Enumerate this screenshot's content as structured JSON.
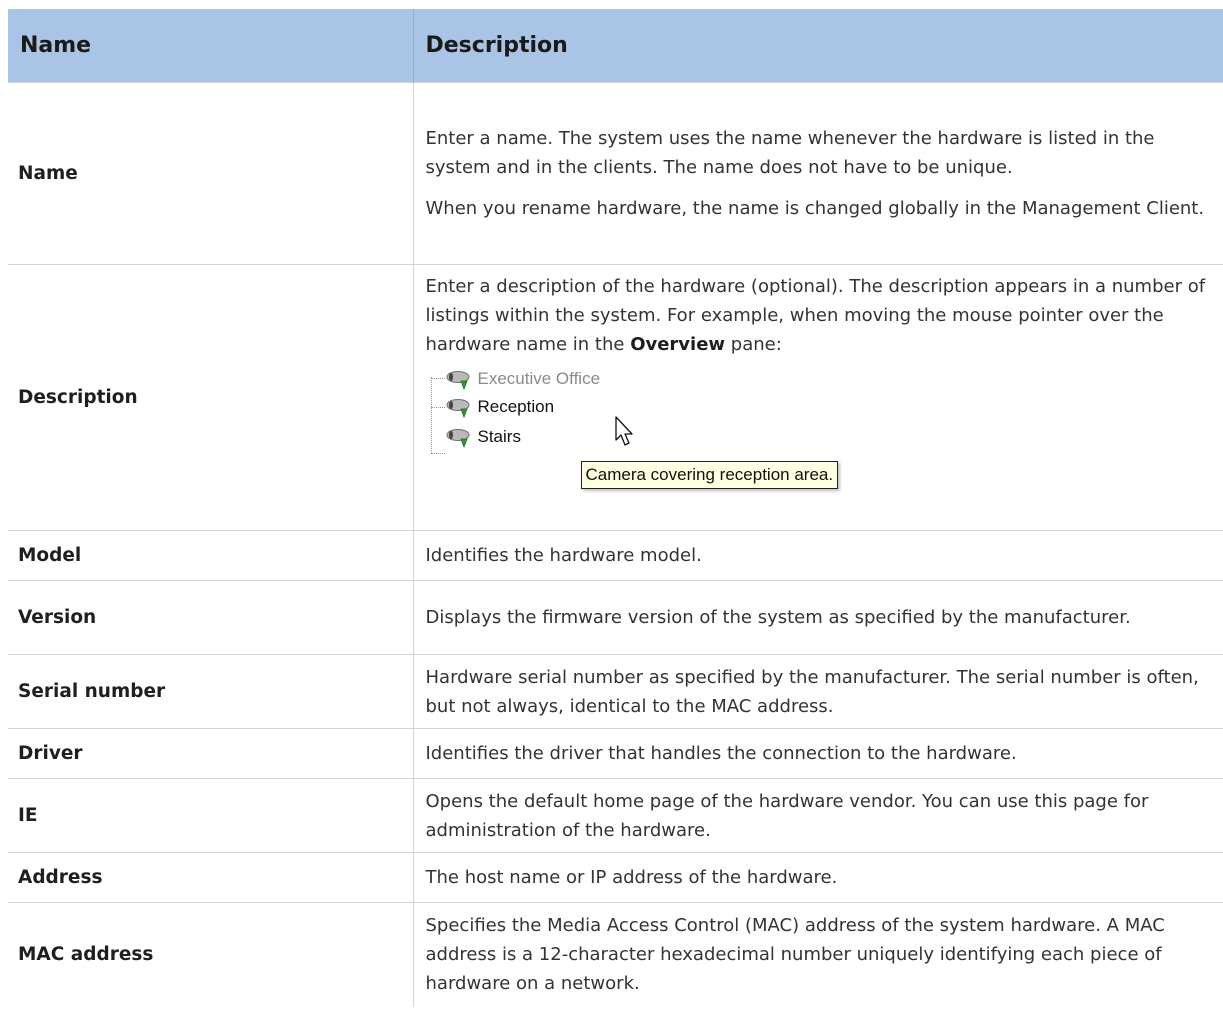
{
  "table": {
    "headers": {
      "name": "Name",
      "description": "Description"
    },
    "rows": [
      {
        "name": "Name",
        "paragraphs": [
          "Enter a name. The system uses the name whenever the hardware is listed in the system and in the clients. The name does not have to be unique.",
          "When you rename hardware, the name is changed globally in the Management Client."
        ]
      },
      {
        "name": "Description",
        "text_before": "Enter a description of the hardware (optional). The description appears in a number of listings within the system. For example, when moving the mouse pointer over the hardware name in the",
        "bold_word": "Overview",
        "text_after": "pane:"
      },
      {
        "name": "Model",
        "text": "Identifies the hardware model."
      },
      {
        "name": "Version",
        "text": "Displays the firmware version of the system as specified by the manufacturer."
      },
      {
        "name": "Serial number",
        "text": "Hardware serial number as specified by the manufacturer. The serial number is often, but not always, identical to the MAC address."
      },
      {
        "name": "Driver",
        "text": "Identifies the driver that handles the connection to the hardware."
      },
      {
        "name": "IE",
        "text": "Opens the default home page of the hardware vendor. You can use this page for administration of the hardware."
      },
      {
        "name": "Address",
        "text": "The host name or IP address of the hardware."
      },
      {
        "name": "MAC address",
        "text": "Specifies the Media Access Control (MAC) address of the system hardware. A MAC address is a 12-character hexadecimal number uniquely identifying each piece of hardware on a network."
      }
    ]
  },
  "screenshot": {
    "items": [
      "Executive Office",
      "Reception",
      "Stairs"
    ],
    "tooltip": "Camera covering reception area.",
    "icons": {
      "camera": "camera-icon",
      "cursor": "mouse-pointer-icon"
    },
    "colors": {
      "camera_body": "#b9b9b9",
      "camera_lens": "#2e9a2e",
      "tooltip_bg": "#ffffe1"
    }
  },
  "colors": {
    "header_bg": "#a9c4e4",
    "row_border": "#d3d3d3"
  }
}
